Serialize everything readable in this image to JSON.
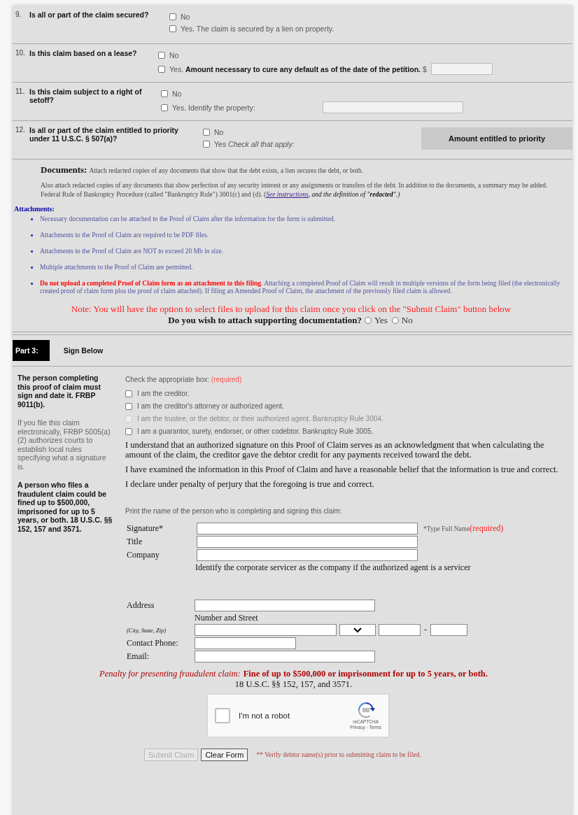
{
  "questions": [
    {
      "number": "9.",
      "question": "Is all or part of the claim secured?",
      "options": [
        {
          "kind": "checkbox",
          "label": "No",
          "checked": false
        },
        {
          "kind": "checkbox",
          "label": "Yes. The claim is secured by a lien on property.",
          "checked": false
        }
      ]
    },
    {
      "number": "10.",
      "question": "Is this claim based on a lease?",
      "options": [
        {
          "kind": "checkbox",
          "label": "No",
          "checked": false
        },
        {
          "kind": "field",
          "label": "Yes. **Amount necessary to cure any default as of the date of the petition.**",
          "prefix": "$",
          "checked": false
        }
      ]
    },
    {
      "number": "11.",
      "question": "Is this claim subject to a right of setoff?",
      "options": [
        {
          "kind": "checkbox",
          "label": "No",
          "checked": false
        },
        {
          "kind": "field",
          "label": "Yes. Identify the property:",
          "checked": false
        }
      ]
    },
    {
      "number": "12.",
      "question": "Is all or part of the claim entitled to priority under 11 U.S.C. § 507(a)?",
      "options": [
        {
          "kind": "checkbox",
          "label": "No",
          "checked": false
        },
        {
          "kind": "checkbox",
          "label": "Yes *Check all that apply:*",
          "checked": false
        }
      ],
      "side_box": "Amount entitled to priority"
    }
  ],
  "documents": {
    "heading": "Documents:",
    "intro": "Attach redacted copies of any documents that show that the debt exists, a lien secures the debt, or both.",
    "paragraph": "Also attach redacted copies of any documents that show perfection of any security interest or any assignments or transfers of the debt. In addition to the documents, a summary may be added. Federal Rule of Bankruptcy Procedure (called \"Bankruptcy Rule\") 3001(c) and (d). (",
    "link": "See instructions",
    "paragraph_end": ", and the definition of \"**redacted**\".)"
  },
  "attachments": {
    "heading": "Attachments:",
    "items": [
      "Necessary documentation can be attached to the Proof of Claim after the information for the form is submitted.",
      "Attachments to the Proof of Claim are required to be PDF files.",
      "Attachments to the Proof of Claim are NOT to exceed 20 Mb in size.",
      "Multiple attachments to the Proof of Claim are permitted.",
      "**Do not upload a completed Proof of Claim form as an attachment to this filing**. Attaching a completed Proof of Claim will result in multiple versions of the form being filed (the electronically created proof of claim form plus the proof of claim attached). If filing an Amended Proof of Claim, the attachment of the previously filed claim is allowed."
    ]
  },
  "note": "Note: You will have the option to select files to upload for this claim once you click on the \"Submit Claim\" button below",
  "attach_question": {
    "question": "Do you wish to attach supporting documentation?",
    "options": [
      {
        "label": "Yes",
        "selected": false
      },
      {
        "label": "No",
        "selected": false
      }
    ]
  },
  "part": {
    "badge": "Part 3:",
    "title": "Sign Below"
  },
  "sign": {
    "sidebar": [
      {
        "kind": "bold",
        "text": "The person completing this proof of claim must sign and date it. FRBP 9011(b)."
      },
      {
        "kind": "plain",
        "text": "If you file this claim electronically, FRBP 5005(a)(2) authorizes courts to establish local rules specifying what a signature is."
      },
      {
        "kind": "bold",
        "text": "A person who files a fraudulent claim could be fined up to $500,000, imprisoned for up to 5 years, or both. 18 U.S.C. §§ 152, 157 and 3571."
      }
    ],
    "check_prompt": "Check the appropriate box:",
    "required": "(required)",
    "roles": [
      {
        "label": "I am the creditor.",
        "checked": false,
        "disabled": false
      },
      {
        "label": "I am the creditor's attorney or authorized agent.",
        "checked": false,
        "disabled": false
      },
      {
        "label": "I am the trustee, or the debtor, or their authorized agent. Bankruptcy Rule 3004.",
        "checked": false,
        "disabled": true
      },
      {
        "label": "I am a guarantor, surety, endorser, or other codebtor. Bankruptcy Rule 3005.",
        "checked": false,
        "disabled": false
      }
    ],
    "statements": [
      "I understand that an authorized signature on this Proof of Claim serves as an acknowledgment that when calculating the amount of the claim, the creditor gave the debtor credit for any payments received toward the debt.",
      "I have examined the information in this Proof of Claim and have a reasonable belief that the information is true and correct.",
      "I declare under penalty of perjury that the foregoing is true and correct."
    ],
    "print_prompt": "Print the name of the person who is completing and signing this claim:",
    "fields": [
      {
        "kind": "wide",
        "label": "Signature*",
        "note": "*Type Full Name",
        "required": "(required)"
      },
      {
        "kind": "wide",
        "label": "Title"
      },
      {
        "kind": "wide",
        "label": "Company",
        "hint": "Identify the corporate servicer as the company if the authorized agent is a servicer"
      },
      {
        "kind": "medium",
        "label": "Address",
        "hint": "Number and Street"
      },
      {
        "kind": "city",
        "label": "(City, State, Zip)",
        "separator": "-"
      },
      {
        "kind": "short",
        "label": "Contact Phone:"
      },
      {
        "kind": "medium",
        "label": "Email:"
      }
    ],
    "penalty": {
      "label": "Penalty for presenting fraudulent claim:",
      "text": "Fine of up to $500,000 or imprisonment for up to 5 years, or both.",
      "citation": "18 U.S.C. §§ 152, 157, and 3571."
    },
    "captcha": {
      "label": "I'm not a robot",
      "checked": false,
      "brand": "reCAPTCHA",
      "links": "Privacy - Terms"
    },
    "buttons": [
      {
        "label": "Submit Claim",
        "disabled": true
      },
      {
        "label": "Clear Form",
        "disabled": false
      }
    ],
    "verify_note": "** Verify debtor name(s) prior to submitting claim to be filed."
  }
}
